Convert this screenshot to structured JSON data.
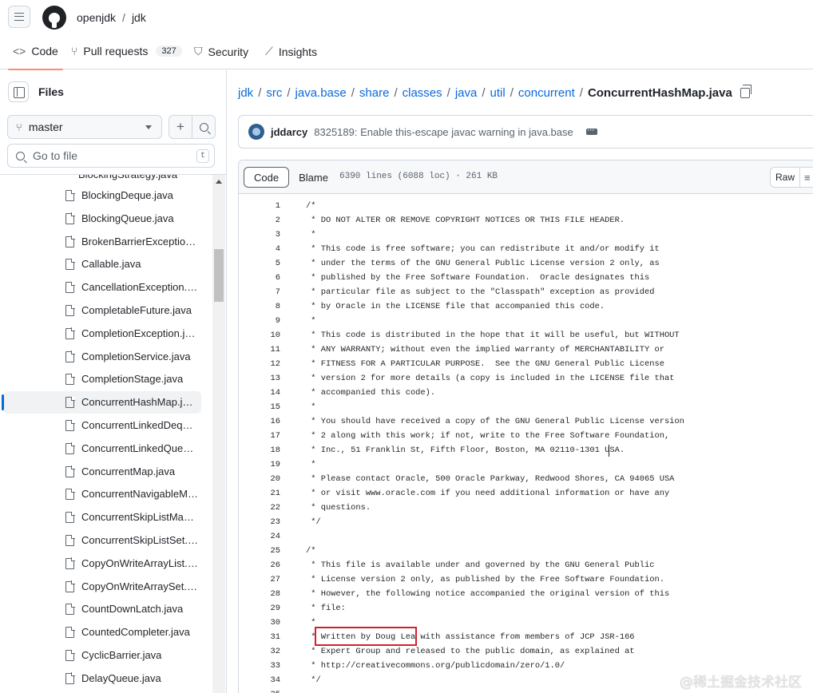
{
  "header": {
    "owner": "openjdk",
    "separator": "/",
    "repo": "jdk"
  },
  "nav": {
    "code": "Code",
    "pull_requests": "Pull requests",
    "pull_requests_count": "327",
    "security": "Security",
    "insights": "Insights"
  },
  "sidebar": {
    "title": "Files",
    "branch": "master",
    "goto_placeholder": "Go to file",
    "goto_shortcut": "t",
    "partial_item": "BlockingStrategy.java",
    "items": [
      "BlockingDeque.java",
      "BlockingQueue.java",
      "BrokenBarrierException.java",
      "Callable.java",
      "CancellationException.java",
      "CompletableFuture.java",
      "CompletionException.java",
      "CompletionService.java",
      "CompletionStage.java",
      "ConcurrentHashMap.java",
      "ConcurrentLinkedDeque.java",
      "ConcurrentLinkedQueue.java",
      "ConcurrentMap.java",
      "ConcurrentNavigableMap.java",
      "ConcurrentSkipListMap.java",
      "ConcurrentSkipListSet.java",
      "CopyOnWriteArrayList.java",
      "CopyOnWriteArraySet.java",
      "CountDownLatch.java",
      "CountedCompleter.java",
      "CyclicBarrier.java",
      "DelayQueue.java"
    ],
    "active_index": 9
  },
  "breadcrumb": {
    "parts": [
      "jdk",
      "src",
      "java.base",
      "share",
      "classes",
      "java",
      "util",
      "concurrent"
    ],
    "current": "ConcurrentHashMap.java"
  },
  "commit": {
    "author": "jddarcy",
    "message": "8325189: Enable this-escape javac warning in java.base"
  },
  "file": {
    "tab_code": "Code",
    "tab_blame": "Blame",
    "meta": "6390 lines (6088 loc) · 261 KB",
    "raw": "Raw",
    "lines": [
      {
        "n": "1",
        "t": "/*"
      },
      {
        "n": "2",
        "t": " * DO NOT ALTER OR REMOVE COPYRIGHT NOTICES OR THIS FILE HEADER."
      },
      {
        "n": "3",
        "t": " *"
      },
      {
        "n": "4",
        "t": " * This code is free software; you can redistribute it and/or modify it"
      },
      {
        "n": "5",
        "t": " * under the terms of the GNU General Public License version 2 only, as"
      },
      {
        "n": "6",
        "t": " * published by the Free Software Foundation.  Oracle designates this"
      },
      {
        "n": "7",
        "t": " * particular file as subject to the \"Classpath\" exception as provided"
      },
      {
        "n": "8",
        "t": " * by Oracle in the LICENSE file that accompanied this code."
      },
      {
        "n": "9",
        "t": " *"
      },
      {
        "n": "10",
        "t": " * This code is distributed in the hope that it will be useful, but WITHOUT"
      },
      {
        "n": "11",
        "t": " * ANY WARRANTY; without even the implied warranty of MERCHANTABILITY or"
      },
      {
        "n": "12",
        "t": " * FITNESS FOR A PARTICULAR PURPOSE.  See the GNU General Public License"
      },
      {
        "n": "13",
        "t": " * version 2 for more details (a copy is included in the LICENSE file that"
      },
      {
        "n": "14",
        "t": " * accompanied this code)."
      },
      {
        "n": "15",
        "t": " *"
      },
      {
        "n": "16",
        "t": " * You should have received a copy of the GNU General Public License version"
      },
      {
        "n": "17",
        "t": " * 2 along with this work; if not, write to the Free Software Foundation,"
      },
      {
        "n": "18",
        "t": " * Inc., 51 Franklin St, Fifth Floor, Boston, MA 02110-1301 USA."
      },
      {
        "n": "19",
        "t": " *"
      },
      {
        "n": "20",
        "t": " * Please contact Oracle, 500 Oracle Parkway, Redwood Shores, CA 94065 USA"
      },
      {
        "n": "21",
        "t": " * or visit www.oracle.com if you need additional information or have any"
      },
      {
        "n": "22",
        "t": " * questions."
      },
      {
        "n": "23",
        "t": " */"
      },
      {
        "n": "24",
        "t": ""
      },
      {
        "n": "25",
        "t": "/*"
      },
      {
        "n": "26",
        "t": " * This file is available under and governed by the GNU General Public"
      },
      {
        "n": "27",
        "t": " * License version 2 only, as published by the Free Software Foundation."
      },
      {
        "n": "28",
        "t": " * However, the following notice accompanied the original version of this"
      },
      {
        "n": "29",
        "t": " * file:"
      },
      {
        "n": "30",
        "t": " *"
      },
      {
        "n": "31",
        "t": " * Written by Doug Lea with assistance from members of JCP JSR-166"
      },
      {
        "n": "32",
        "t": " * Expert Group and released to the public domain, as explained at"
      },
      {
        "n": "33",
        "t": " * http://creativecommons.org/publicdomain/zero/1.0/"
      },
      {
        "n": "34",
        "t": " */"
      },
      {
        "n": "35",
        "t": ""
      }
    ]
  },
  "watermark": "@稀土掘金技术社区",
  "colors": {
    "link": "#0969da",
    "highlight_box": "#d81e2c",
    "tab_underline": "#fd8c73"
  }
}
